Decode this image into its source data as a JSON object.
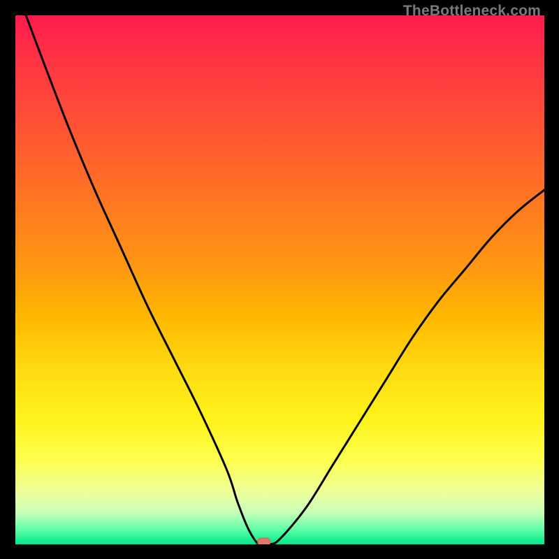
{
  "watermark": "TheBottleneck.com",
  "chart_data": {
    "type": "line",
    "title": "",
    "xlabel": "",
    "ylabel": "",
    "xlim": [
      0,
      100
    ],
    "ylim": [
      0,
      100
    ],
    "grid": false,
    "series": [
      {
        "name": "bottleneck-curve",
        "x": [
          2,
          5,
          10,
          15,
          20,
          25,
          30,
          35,
          40,
          42,
          44,
          46,
          48,
          50,
          55,
          60,
          65,
          70,
          75,
          80,
          85,
          90,
          95,
          100
        ],
        "y": [
          100,
          92,
          79,
          67,
          56,
          45,
          35,
          25,
          14,
          8,
          3,
          0,
          0,
          1,
          7,
          15,
          23,
          31,
          39,
          46,
          52,
          58,
          63,
          67
        ]
      }
    ],
    "marker": {
      "x": 47,
      "y": 0
    },
    "gradient_stops": [
      {
        "pos": 0.0,
        "color": "#ff1a4d"
      },
      {
        "pos": 0.5,
        "color": "#ffbb00"
      },
      {
        "pos": 0.8,
        "color": "#fff21a"
      },
      {
        "pos": 1.0,
        "color": "#00e888"
      }
    ]
  }
}
